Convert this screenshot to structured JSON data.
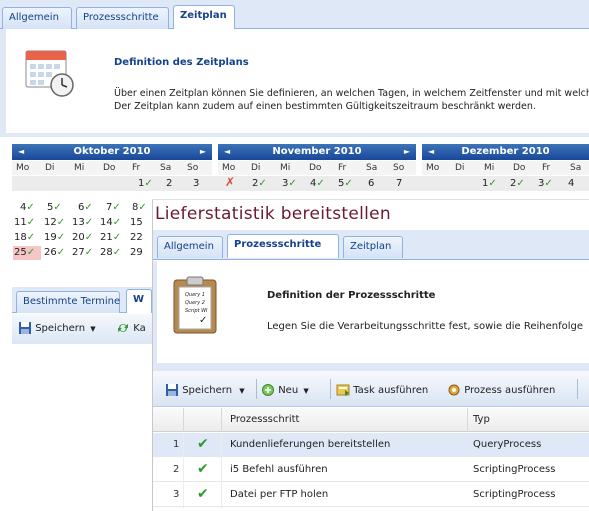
{
  "back": {
    "tabs": [
      "Allgemein",
      "Prozessschritte",
      "Zeitplan"
    ],
    "section_title": "Definition des Zeitplans",
    "section_line1": "Über einen Zeitplan können Sie definieren, an welchen Tagen, in welchem Zeitfenster und mit welch",
    "section_line2": "Der Zeitplan kann zudem auf einen bestimmten Gültigkeitszeitraum beschränkt werden.",
    "weekdays": [
      "Mo",
      "Di",
      "Mi",
      "Do",
      "Fr",
      "Sa",
      "So"
    ],
    "months": [
      {
        "name": "Oktober 2010"
      },
      {
        "name": "November 2010"
      },
      {
        "name": "Dezember 2010"
      }
    ],
    "oct_rows": [
      [
        "",
        "",
        "",
        "",
        "1✓",
        "2",
        "3"
      ],
      [
        "4✓",
        "5✓",
        "6✓",
        "7✓",
        "8✓",
        "",
        ""
      ],
      [
        "11✓",
        "12✓",
        "13✓",
        "14✓",
        "15",
        "",
        ""
      ],
      [
        "18✓",
        "19✓",
        "20✓",
        "21✓",
        "22",
        "",
        ""
      ],
      [
        "25✓",
        "26✓",
        "27✓",
        "28✓",
        "29",
        "",
        ""
      ]
    ],
    "nov_row": [
      "✗",
      "2✓",
      "3✓",
      "4✓",
      "5✓",
      "6",
      "7"
    ],
    "dec_row": [
      "",
      "",
      "1✓",
      "2✓",
      "3✓",
      "4",
      ""
    ],
    "bottom_tabs": [
      "Bestimmte Termine",
      "W"
    ],
    "save_label": "Speichern",
    "ka_label": "Ka"
  },
  "front": {
    "window_title": "Lieferstatistik bereitstellen",
    "tabs": [
      "Allgemein",
      "Prozessschritte",
      "Zeitplan"
    ],
    "section_title": "Definition der Prozessschritte",
    "section_text": "Legen Sie die Verarbeitungsschritte fest, sowie die Reihenfolge",
    "clipboard_lines": [
      "Query 1",
      "Query 2",
      "Script WI"
    ],
    "toolbar": {
      "save": "Speichern",
      "new": "Neu",
      "task": "Task ausführen",
      "process": "Prozess ausführen"
    },
    "columns": [
      "Prozessschritt",
      "Typ"
    ],
    "rows": [
      {
        "num": "1",
        "step": "Kundenlieferungen bereitstellen",
        "type": "QueryProcess"
      },
      {
        "num": "2",
        "step": "i5 Befehl ausführen",
        "type": "ScriptingProcess"
      },
      {
        "num": "3",
        "step": "Datei per FTP holen",
        "type": "ScriptingProcess"
      }
    ]
  },
  "colors": {
    "accent": "#15428b",
    "title": "#6b1a2e",
    "selected_row": "#dfe8f6",
    "check": "#2e9a2e"
  }
}
